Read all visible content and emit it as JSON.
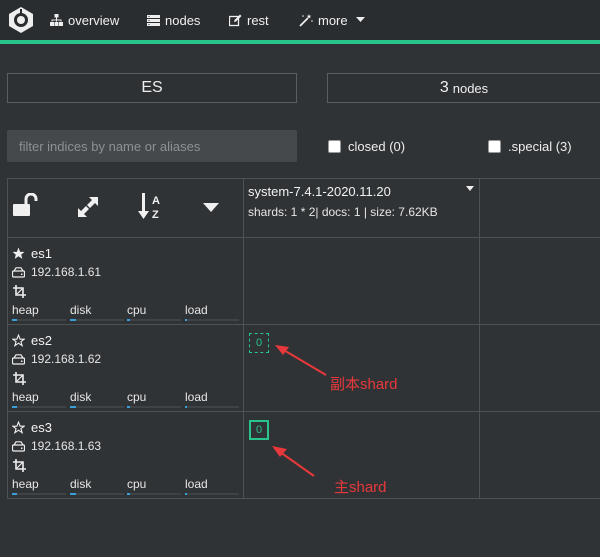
{
  "nav": {
    "items": [
      {
        "label": "overview",
        "icon": "sitemap-icon"
      },
      {
        "label": "nodes",
        "icon": "server-icon"
      },
      {
        "label": "rest",
        "icon": "edit-icon"
      },
      {
        "label": "more",
        "icon": "magic-wand-icon"
      }
    ]
  },
  "cluster": {
    "name": "ES",
    "node_count": "3",
    "node_count_suffix": "nodes"
  },
  "filter": {
    "placeholder": "filter indices by name or aliases"
  },
  "checkboxes": {
    "closed": "closed (0)",
    "special": ".special (3)"
  },
  "index": {
    "name": "system-7.4.1-2020.11.20",
    "meta": "shards: 1 * 2| docs: 1 | size: 7.62KB"
  },
  "metric_labels": [
    "heap",
    "disk",
    "cpu",
    "load"
  ],
  "nodes": [
    {
      "name": "es1",
      "ip": "192.168.1.61",
      "master": true
    },
    {
      "name": "es2",
      "ip": "192.168.1.62",
      "master": false
    },
    {
      "name": "es3",
      "ip": "192.168.1.63",
      "master": false
    }
  ],
  "shards": {
    "replica": {
      "label": "0",
      "node": "es2"
    },
    "primary": {
      "label": "0",
      "node": "es3"
    }
  },
  "annotations": {
    "replica": "副本shard",
    "primary": "主shard"
  },
  "colors": {
    "accent": "#29c48b",
    "annotation": "#e8383b",
    "background": "#303335"
  }
}
